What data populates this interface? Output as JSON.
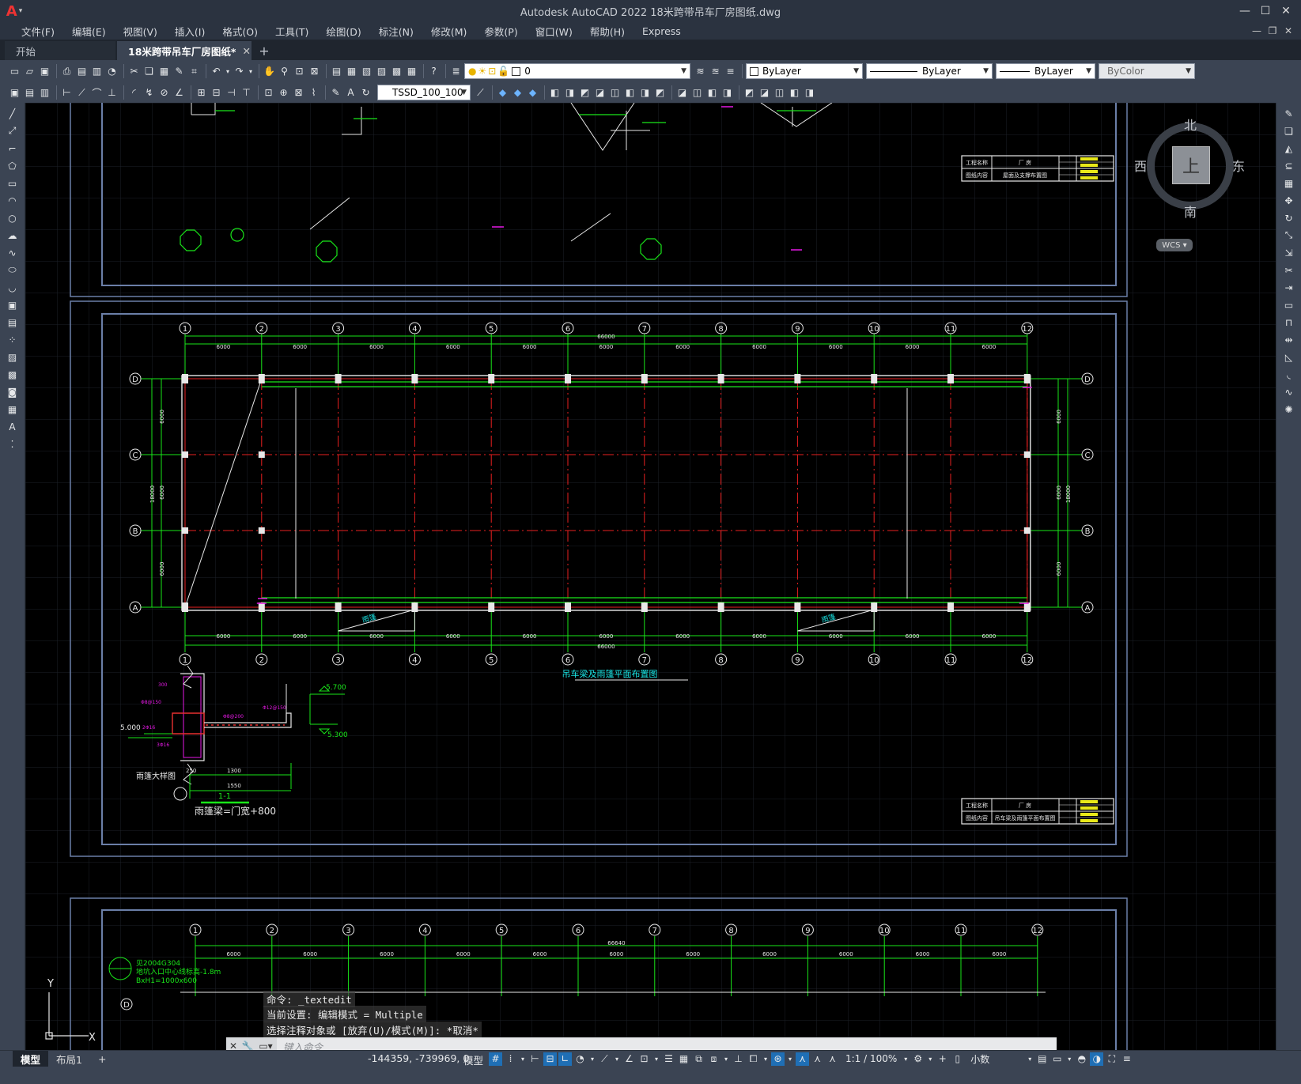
{
  "titlebar": {
    "logo": "A",
    "title": "Autodesk AutoCAD 2022    18米跨带吊车厂房图纸.dwg",
    "min": "—",
    "max": "☐",
    "close": "✕"
  },
  "menu": [
    "文件(F)",
    "编辑(E)",
    "视图(V)",
    "插入(I)",
    "格式(O)",
    "工具(T)",
    "绘图(D)",
    "标注(N)",
    "修改(M)",
    "参数(P)",
    "窗口(W)",
    "帮助(H)",
    "Express"
  ],
  "doc_tabs": {
    "start": "开始",
    "active": "18米跨带吊车厂房图纸*",
    "close": "✕",
    "add": "+"
  },
  "toolbar1": {
    "layer_value": "0",
    "color_value": "ByLayer",
    "linetype_value": "ByLayer",
    "lineweight_value": "ByLayer",
    "plotstyle_value": "ByColor"
  },
  "toolbar2": {
    "dimstyle_value": "TSSD_100_100"
  },
  "viewcube": {
    "top": "上",
    "north": "北",
    "south": "南",
    "east": "东",
    "west": "西",
    "wcs": "WCS"
  },
  "drawing": {
    "axis_numbers": [
      "1",
      "2",
      "3",
      "4",
      "5",
      "6",
      "7",
      "8",
      "9",
      "10",
      "11",
      "12"
    ],
    "axis_letters": [
      "D",
      "C",
      "B",
      "A"
    ],
    "bay_dim": "6000",
    "total_length": "66000",
    "total_width": "18000",
    "plan_title": "吊车梁及雨篷平面布置图",
    "canopy_label": "雨篷",
    "detail_title": "雨篷大样图",
    "section_label": "1-1",
    "canopy_note": "雨篷梁=门宽+800",
    "elev_top": "5.700",
    "elev_mid": "5.000",
    "elev_bottom": "5.300",
    "detail_dims": [
      "250",
      "1300",
      "1550"
    ],
    "titleblock": {
      "project_label": "工程名称",
      "project_value": "厂 房",
      "content_label": "图纸内容",
      "content_upper": "屋面及支撑布置图",
      "content_lower": "吊车梁及雨篷平面布置图"
    },
    "bottom_note_1": "见2004G304",
    "bottom_note_2": "地坑入口中心线标高-1.8m",
    "bottom_note_3": "BxH1=1000x600",
    "bottom_total": "66640",
    "ucs_y": "Y",
    "ucs_x": "X"
  },
  "command": {
    "history": [
      "命令: _textedit",
      "当前设置: 编辑模式 = Multiple",
      "选择注释对象或 [放弃(U)/模式(M)]: *取消*"
    ],
    "placeholder": "键入命令"
  },
  "status": {
    "layouts": [
      "模型",
      "布局1"
    ],
    "add_layout": "+",
    "coords": "-144359, -739969, 0",
    "model": "模型",
    "scale": "1:1 / 100%",
    "units": "小数"
  }
}
